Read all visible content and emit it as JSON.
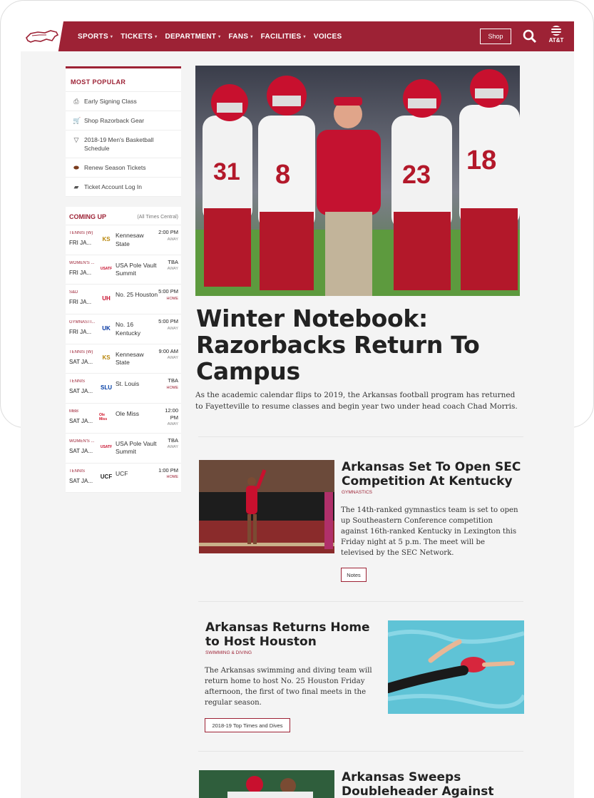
{
  "header": {
    "nav": [
      "SPORTS",
      "TICKETS",
      "DEPARTMENT",
      "FANS",
      "FACILITIES",
      "VOICES"
    ],
    "nav_has_caret": [
      true,
      true,
      true,
      true,
      true,
      false
    ],
    "shop_label": "Shop",
    "att_label": "AT&T"
  },
  "sidebar": {
    "popular_title": "MOST POPULAR",
    "popular_items": [
      {
        "icon": "printer-icon",
        "label": "Early Signing Class"
      },
      {
        "icon": "cart-icon",
        "label": "Shop Razorback Gear"
      },
      {
        "icon": "basketball-hoop-icon",
        "label": "2018-19 Men's Basketball Schedule"
      },
      {
        "icon": "football-icon",
        "label": "Renew Season Tickets"
      },
      {
        "icon": "ticket-icon",
        "label": "Ticket Account Log In"
      }
    ],
    "coming_title": "COMING UP",
    "coming_sub": "(All Times Central)",
    "games": [
      {
        "sport": "TENNIS (W)",
        "date": "FRI JA...",
        "opp": "Kennesaw State",
        "time": "2:00 PM",
        "loc": "AWAY",
        "logo": "KS",
        "logo_color": "#b8860b"
      },
      {
        "sport": "WOMEN'S ...",
        "date": "FRI JA...",
        "opp": "USA Pole Vault Summit",
        "time": "TBA",
        "loc": "AWAY",
        "logo": "USATF",
        "logo_color": "#c8102e"
      },
      {
        "sport": "S&D",
        "date": "FRI JA...",
        "opp": "No. 25 Houston",
        "time": "5:00 PM",
        "loc": "HOME",
        "logo": "UH",
        "logo_color": "#c8102e"
      },
      {
        "sport": "GYMNASTI...",
        "date": "FRI JA...",
        "opp": "No. 16 Kentucky",
        "time": "5:00 PM",
        "loc": "AWAY",
        "logo": "UK",
        "logo_color": "#0033a0"
      },
      {
        "sport": "TENNIS (W)",
        "date": "SAT JA...",
        "opp": "Kennesaw State",
        "time": "9:00 AM",
        "loc": "AWAY",
        "logo": "KS",
        "logo_color": "#b8860b"
      },
      {
        "sport": "TENNIS",
        "date": "SAT JA...",
        "opp": "St. Louis",
        "time": "TBA",
        "loc": "HOME",
        "logo": "SLU",
        "logo_color": "#003da5"
      },
      {
        "sport": "MBB",
        "date": "SAT JA...",
        "opp": "Ole Miss",
        "time": "12:00 PM",
        "loc": "AWAY",
        "logo": "Ole Miss",
        "logo_color": "#ce1126"
      },
      {
        "sport": "WOMEN'S ...",
        "date": "SAT JA...",
        "opp": "USA Pole Vault Summit",
        "time": "TBA",
        "loc": "AWAY",
        "logo": "USATF",
        "logo_color": "#c8102e"
      },
      {
        "sport": "TENNIS",
        "date": "SAT JA...",
        "opp": "UCF",
        "time": "1:00 PM",
        "loc": "HOME",
        "logo": "UCF",
        "logo_color": "#222222"
      }
    ]
  },
  "main": {
    "hero_headline": "Winter Notebook: Razorbacks Return To Campus",
    "hero_dek": "As the academic calendar flips to 2019, the Arkansas football program has returned to Fayetteville to resume classes and begin year two under head coach Chad Morris.",
    "stories": [
      {
        "title": "Arkansas Set To Open SEC Competition At Kentucky",
        "category": "GYMNASTICS",
        "body": "The 14th-ranked gymnastics team is set to open up Southeastern Conference competition against 16th-ranked Kentucky in Lexington this Friday night at 5 p.m. The meet will be televised by the SEC Network.",
        "button": "Notes"
      },
      {
        "title": "Arkansas Returns Home to Host Houston",
        "category": "SWIMMING & DIVING",
        "body": "The Arkansas swimming and diving team will return home to host No. 25 Houston Friday afternoon, the first of two final meets in the regular season.",
        "button": "2018-19 Top Times and Dives"
      },
      {
        "title": "Arkansas Sweeps Doubleheader Against",
        "category": "",
        "body": "",
        "button": ""
      }
    ]
  },
  "colors": {
    "brand": "#9d2235",
    "page_bg": "#f4f4f4"
  }
}
